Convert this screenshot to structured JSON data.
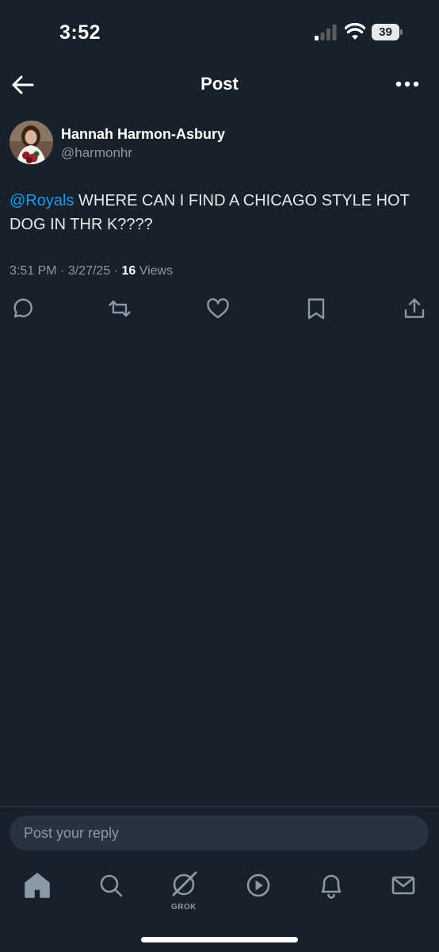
{
  "status_bar": {
    "time": "3:52",
    "battery": "39",
    "icons": [
      "signal-icon",
      "wifi-icon",
      "battery-icon"
    ]
  },
  "header": {
    "title": "Post",
    "back_icon": "arrow-left-icon",
    "more_icon": "more-horizontal-icon"
  },
  "post": {
    "author": {
      "display_name": "Hannah Harmon-Asbury",
      "handle": "@harmonhr"
    },
    "mention": "@Royals",
    "text": " WHERE CAN I FIND A CHICAGO STYLE HOT DOG IN THR K????",
    "time": "3:51 PM",
    "date": "3/27/25",
    "views_count": "16",
    "views_label": "Views",
    "separator": "·"
  },
  "actions": [
    "reply-icon",
    "repost-icon",
    "like-icon",
    "bookmark-icon",
    "share-icon"
  ],
  "reply": {
    "placeholder": "Post your reply"
  },
  "tabbar": {
    "grok_label": "GROK",
    "icons": [
      "home-icon",
      "search-icon",
      "grok-icon",
      "video-icon",
      "notifications-icon",
      "messages-icon"
    ]
  },
  "colors": {
    "background": "#17202b",
    "accent": "#1d9bf0",
    "secondary_text": "#8b98a5"
  }
}
